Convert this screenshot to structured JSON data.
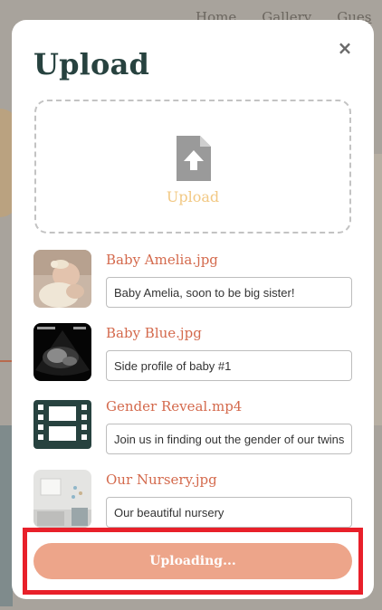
{
  "background": {
    "nav": [
      "Home",
      "Gallery",
      "Gues"
    ]
  },
  "modal": {
    "title": "Upload",
    "close_label": "×",
    "dropzone": {
      "label": "Upload",
      "icon": "file-upload-icon"
    },
    "files": [
      {
        "name": "Baby Amelia.jpg",
        "caption": "Baby Amelia, soon to be big sister!",
        "thumbnail": "baby-photo"
      },
      {
        "name": "Baby Blue.jpg",
        "caption": "Side profile of baby #1",
        "thumbnail": "ultrasound-photo"
      },
      {
        "name": "Gender Reveal.mp4",
        "caption": "Join us in finding out the gender of our twins",
        "thumbnail": "film-icon"
      },
      {
        "name": "Our Nursery.jpg",
        "caption": "Our beautiful nursery",
        "thumbnail": "nursery-photo"
      }
    ],
    "submit_label": "Uploading..."
  },
  "colors": {
    "title": "#27423f",
    "file_name": "#d46a4d",
    "dropzone_label": "#f2c883",
    "button": "#eda58a",
    "highlight": "#e8202a"
  }
}
